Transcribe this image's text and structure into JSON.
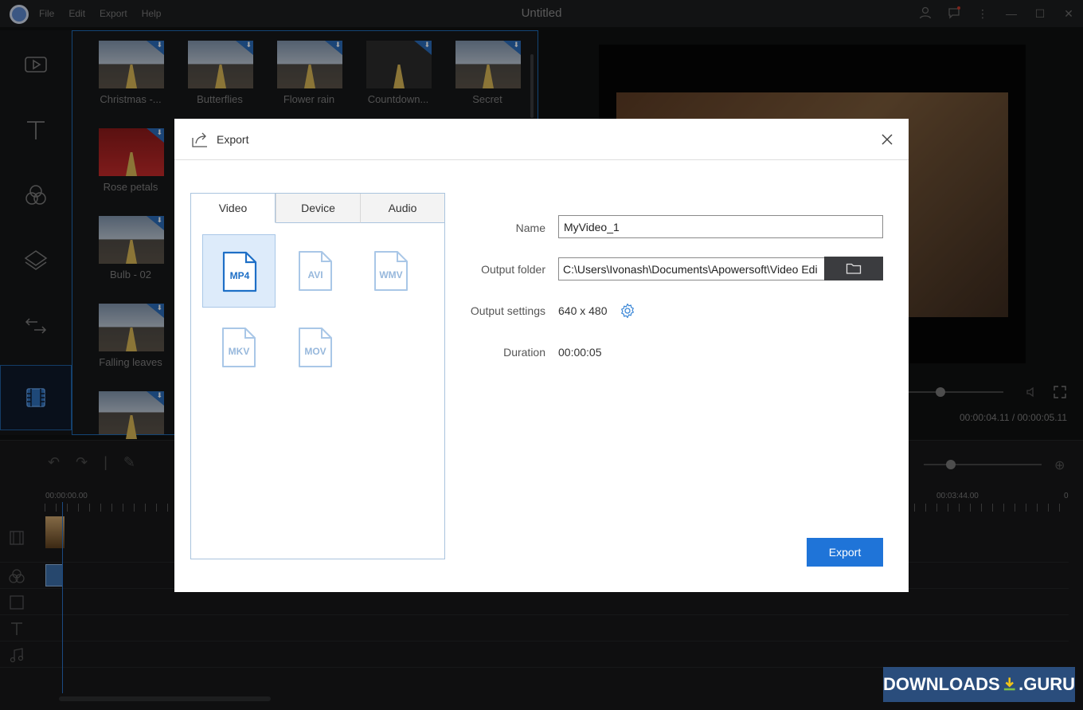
{
  "window": {
    "title": "Untitled",
    "menu": [
      "File",
      "Edit",
      "Export",
      "Help"
    ]
  },
  "library": {
    "effects": [
      {
        "label": "Christmas -..."
      },
      {
        "label": "Butterflies"
      },
      {
        "label": "Flower rain"
      },
      {
        "label": "Countdown..."
      },
      {
        "label": "Secret"
      },
      {
        "label": "Rose petals"
      },
      {
        "label": "Bulb - 02"
      },
      {
        "label": "Falling leaves"
      }
    ]
  },
  "preview": {
    "time_readout": "00:00:04.11 / 00:00:05.11"
  },
  "timeline": {
    "ruler": [
      "00:00:00.00",
      "00:03:44.00",
      "0"
    ]
  },
  "dialog": {
    "title": "Export",
    "tabs": [
      "Video",
      "Device",
      "Audio"
    ],
    "active_tab": "Video",
    "formats": [
      "MP4",
      "AVI",
      "WMV",
      "MKV",
      "MOV"
    ],
    "selected_format": "MP4",
    "fields": {
      "name_label": "Name",
      "name_value": "MyVideo_1",
      "folder_label": "Output folder",
      "folder_value": "C:\\Users\\Ivonash\\Documents\\Apowersoft\\Video Edi",
      "settings_label": "Output settings",
      "settings_value": "640 x 480",
      "duration_label": "Duration",
      "duration_value": "00:00:05"
    },
    "export_label": "Export"
  },
  "watermark": {
    "left": "DOWNLOADS",
    "right": ".GURU"
  },
  "colors": {
    "accent": "#1f74d8",
    "selected_tile": "#ddebfa",
    "format_icon": "#97b8dc"
  }
}
